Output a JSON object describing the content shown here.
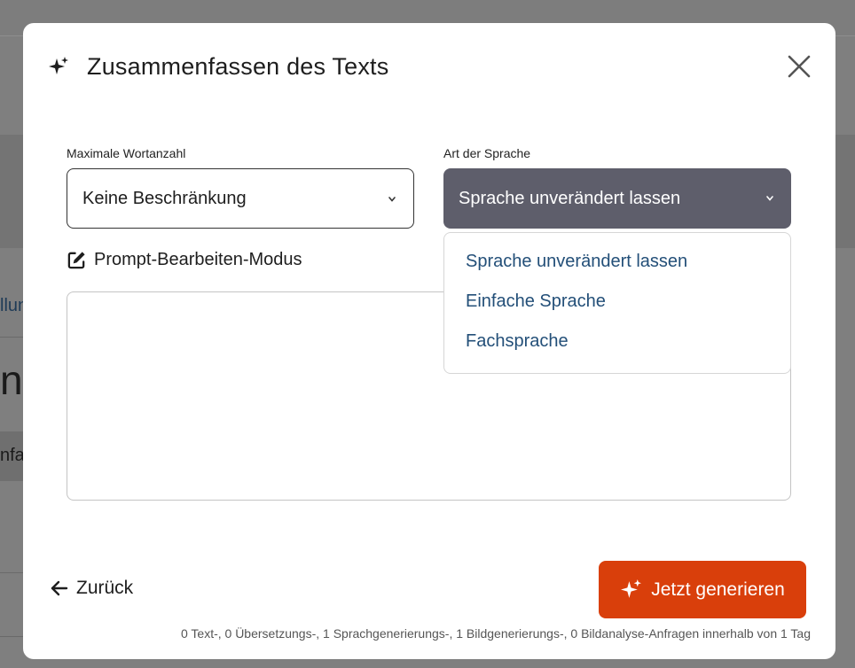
{
  "background": {
    "link_fragment": "llun",
    "heading_fragment": "n",
    "tab_fragment": "nfa"
  },
  "modal": {
    "title": "Zusammenfassen des Texts",
    "icons": {
      "title": "sparkle-icon",
      "close": "close-icon"
    },
    "word_limit": {
      "label": "Maximale Wortanzahl",
      "value": "Keine Beschränkung"
    },
    "language": {
      "label": "Art der Sprache",
      "value": "Sprache unverändert lassen",
      "options": [
        "Sprache unverändert lassen",
        "Einfache Sprache",
        "Fachsprache"
      ]
    },
    "prompt_mode": {
      "label": "Prompt-Bearbeiten-Modus",
      "icon": "edit-icon"
    },
    "prompt_text": "",
    "back_label": "Zurück",
    "generate_label": "Jetzt generieren",
    "quota_text": "0 Text-, 0 Übersetzungs-, 1 Sprachgenerierungs-, 1 Bildgenerierungs-, 0 Bildanalyse-Anfragen innerhalb von 1 Tag"
  },
  "colors": {
    "accent": "#d93f0b",
    "select_active": "#5e5e6b",
    "option_text": "#234f78"
  }
}
